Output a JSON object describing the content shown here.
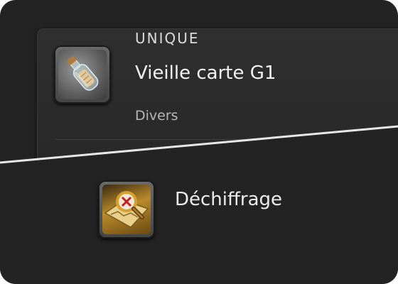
{
  "item": {
    "rarity": "UNIQUE",
    "name": "Vieille carte G1",
    "type": "Divers",
    "icon": "message-bottle-icon"
  },
  "action": {
    "name": "Déchiffrage",
    "icon": "decipher-map-icon"
  },
  "colors": {
    "background": "#232324",
    "panel": "#2c2c2c",
    "text": "#f2f2f2",
    "subtext": "#b8b8b8"
  }
}
